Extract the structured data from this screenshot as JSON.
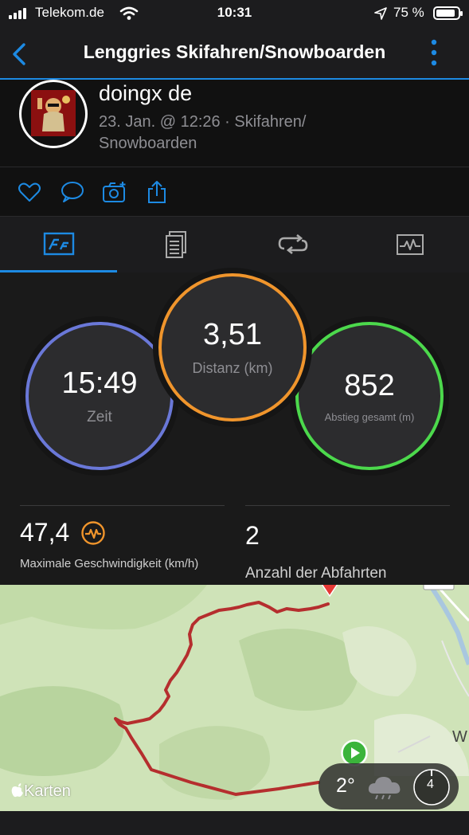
{
  "status_bar": {
    "carrier": "Telekom.de",
    "time": "10:31",
    "battery": "75 %"
  },
  "nav": {
    "title": "Lenggries Skifahren/Snowboarden"
  },
  "profile": {
    "username": "doingx de",
    "meta_line1": "23. Jan. @ 12:26 · Skifahren/",
    "meta_line2": "Snowboarden"
  },
  "stats": {
    "time": {
      "value": "15:49",
      "label": "Zeit",
      "color": "#5b8fe0"
    },
    "distance": {
      "value": "3,51",
      "label": "Distanz (km)",
      "color": "#f0952c"
    },
    "descent": {
      "value": "852",
      "label": "Abstieg gesamt (m)",
      "color": "#4cd94c"
    }
  },
  "metrics": {
    "max_speed": {
      "value": "47,4",
      "label": "Maximale Geschwindigkeit (km/h)"
    },
    "runs": {
      "value": "2",
      "label": "Anzahl der Abfahrten"
    }
  },
  "map": {
    "attribution": "Karten",
    "edge_letter": "W",
    "route_color": "#b52e2e",
    "weather": {
      "temp": "2°",
      "wind": "4"
    }
  },
  "colors": {
    "accent": "#1d8ae3",
    "background": "#111111"
  }
}
